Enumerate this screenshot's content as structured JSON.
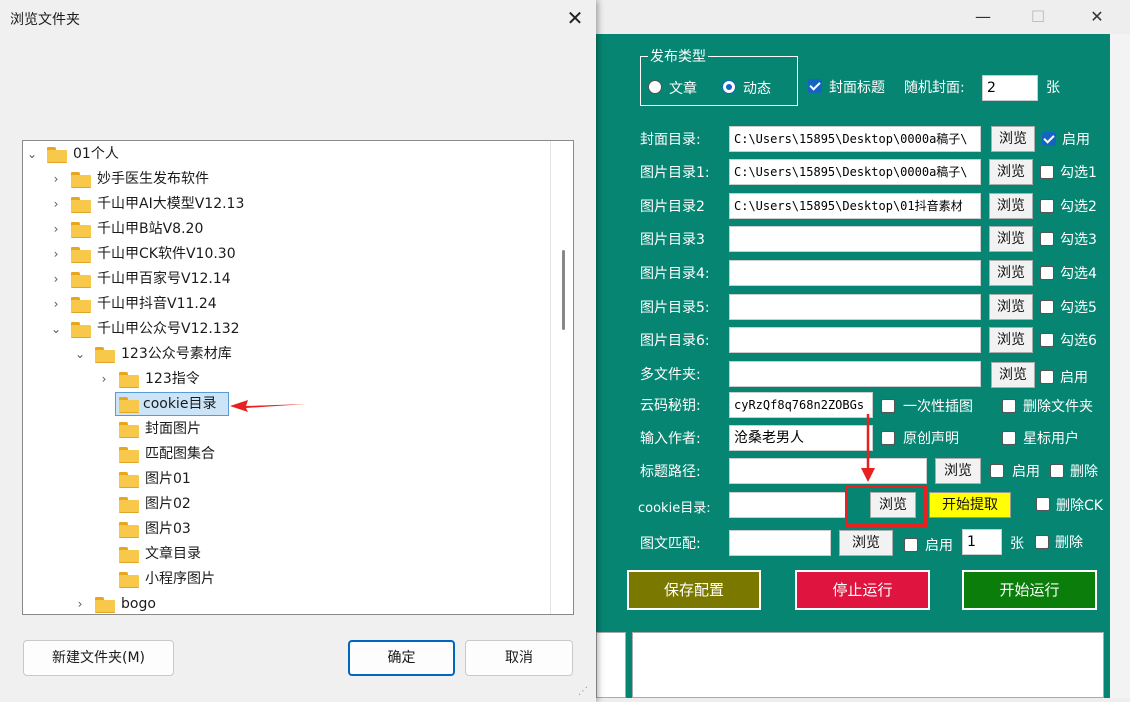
{
  "dialog": {
    "title": "浏览文件夹",
    "tree": [
      {
        "label": "01个人",
        "expanded": true,
        "level": 0
      },
      {
        "label": "妙手医生发布软件",
        "level": 1
      },
      {
        "label": "千山甲AI大模型V12.13",
        "level": 1
      },
      {
        "label": "千山甲B站V8.20",
        "level": 1
      },
      {
        "label": "千山甲CK软件V10.30",
        "level": 1
      },
      {
        "label": "千山甲百家号V12.14",
        "level": 1
      },
      {
        "label": "千山甲抖音V11.24",
        "level": 1
      },
      {
        "label": "千山甲公众号V12.132",
        "expanded": true,
        "level": 1
      },
      {
        "label": "123公众号素材库",
        "expanded": true,
        "level": 2
      },
      {
        "label": "123指令",
        "level": 3
      },
      {
        "label": "cookie目录",
        "selected": true,
        "level": 3
      },
      {
        "label": "封面图片",
        "level": 3
      },
      {
        "label": "匹配图集合",
        "level": 3
      },
      {
        "label": "图片01",
        "level": 3
      },
      {
        "label": "图片02",
        "level": 3
      },
      {
        "label": "图片03",
        "level": 3
      },
      {
        "label": "文章目录",
        "level": 3
      },
      {
        "label": "小程序图片",
        "level": 3
      },
      {
        "label": "bogo",
        "level": 2
      }
    ],
    "new_folder_label": "新建文件夹(M)",
    "ok_label": "确定",
    "cancel_label": "取消"
  },
  "app": {
    "publish_group": {
      "title": "发布类型",
      "article": "文章",
      "dynamic": "动态"
    },
    "cover_title": "封面标题",
    "random_cover_label": "随机封面:",
    "random_cover_value": "2",
    "unit_zhang": "张",
    "browse": "浏览",
    "rows": [
      {
        "label": "封面目录:",
        "value": "C:\\Users\\15895\\Desktop\\0000a稿子\\",
        "check": "启用",
        "checked": true
      },
      {
        "label": "图片目录1:",
        "value": "C:\\Users\\15895\\Desktop\\0000a稿子\\",
        "check": "勾选1"
      },
      {
        "label": "图片目录2",
        "value": "C:\\Users\\15895\\Desktop\\01抖音素材",
        "check": "勾选2"
      },
      {
        "label": "图片目录3",
        "value": "",
        "check": "勾选3"
      },
      {
        "label": "图片目录4:",
        "value": "",
        "check": "勾选4"
      },
      {
        "label": "图片目录5:",
        "value": "",
        "check": "勾选5"
      },
      {
        "label": "图片目录6:",
        "value": "",
        "check": "勾选6"
      },
      {
        "label": "多文件夹:",
        "value": "",
        "check": "启用"
      }
    ],
    "secret_label": "云码秘钥:",
    "secret_value": "cyRzQf8q768n2ZOBGs",
    "one_time_insert": "一次性插图",
    "delete_folder": "删除文件夹",
    "author_label": "输入作者:",
    "author_value": "沧桑老男人",
    "original": "原创声明",
    "star_user": "星标用户",
    "title_path_label": "标题路径:",
    "enable": "启用",
    "delete": "删除",
    "cookie_label": "cookie目录:",
    "start_extract": "开始提取",
    "delete_ck": "删除CK",
    "match_label": "图文匹配:",
    "match_count": "1",
    "save_config": "保存配置",
    "stop_run": "停止运行",
    "start_run": "开始运行"
  },
  "colors": {
    "teal": "#078573",
    "save": "#7b7800",
    "stop": "#e0153f",
    "start": "#0a7d0a",
    "highlight": "#e82020",
    "extract": "#ffff00"
  }
}
